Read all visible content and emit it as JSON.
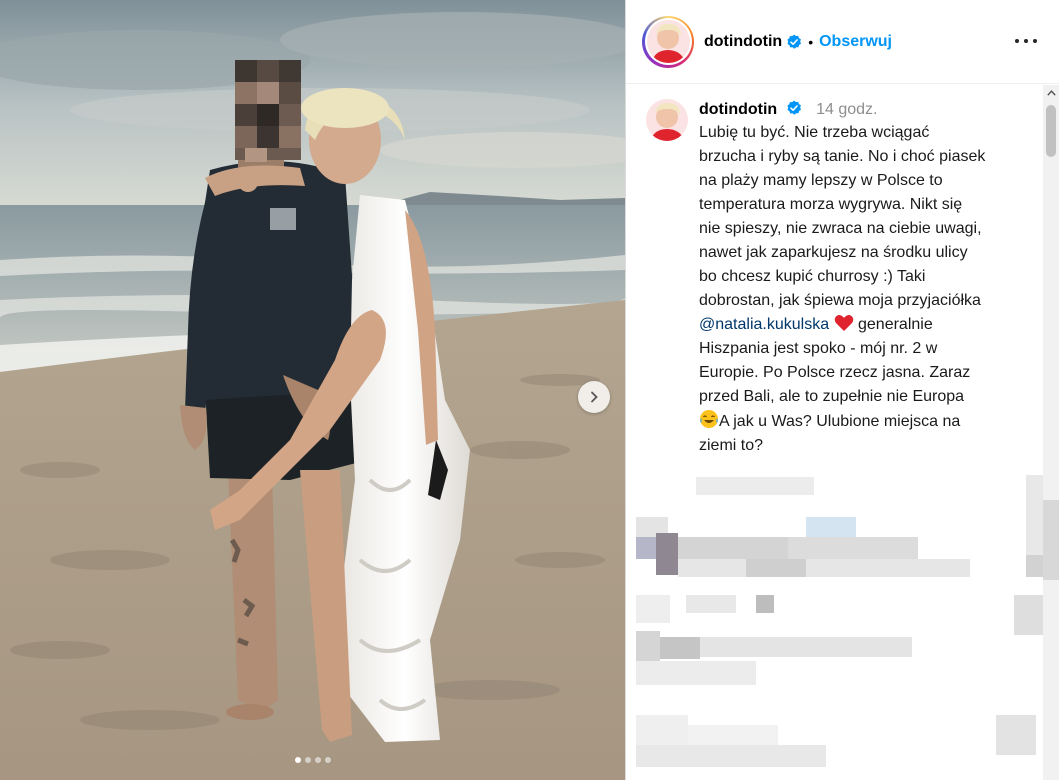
{
  "post": {
    "username": "dotindotin",
    "follow_label": "Obserwuj",
    "separator": "•",
    "more_label": "More options",
    "time": "14 godz.",
    "caption_part1": "Lubię tu być. Nie trzeba wciągać\nbrzucha i ryby są tanie. No i choć piasek\nna plaży mamy lepszy w Polsce to\ntemperatura morza wygrywa. Nikt się\nnie spieszy, nie zwraca na ciebie uwagi,\nnawet jak zaparkujesz na środku ulicy\nbo chcesz kupić churrosy :) Taki\ndobrostan, jak śpiewa moja przyjaciółka\n",
    "mention": "@natalia.kukulska",
    "caption_part2": " generalnie\nHiszpania jest spoko - mój nr. 2 w\nEuropie. Po Polsce rzecz jasna. Zaraz\nprzed Bali, ale to zupełnie nie Europa\n",
    "caption_part3": "A jak u Was? Ulubione miejsca na\nziemi to?"
  },
  "carousel": {
    "total": 4,
    "active_index": 0,
    "next_icon": "chevron-right-icon"
  },
  "icons": {
    "verified": "verified-badge-icon",
    "heart": "red-heart-emoji",
    "laugh": "tears-of-joy-emoji",
    "scroll_up": "scroll-up-arrow-icon"
  },
  "colors": {
    "link": "#0095f6",
    "mention": "#00376b",
    "secondary_text": "#8e8e8e",
    "verified": "#0095f6"
  }
}
